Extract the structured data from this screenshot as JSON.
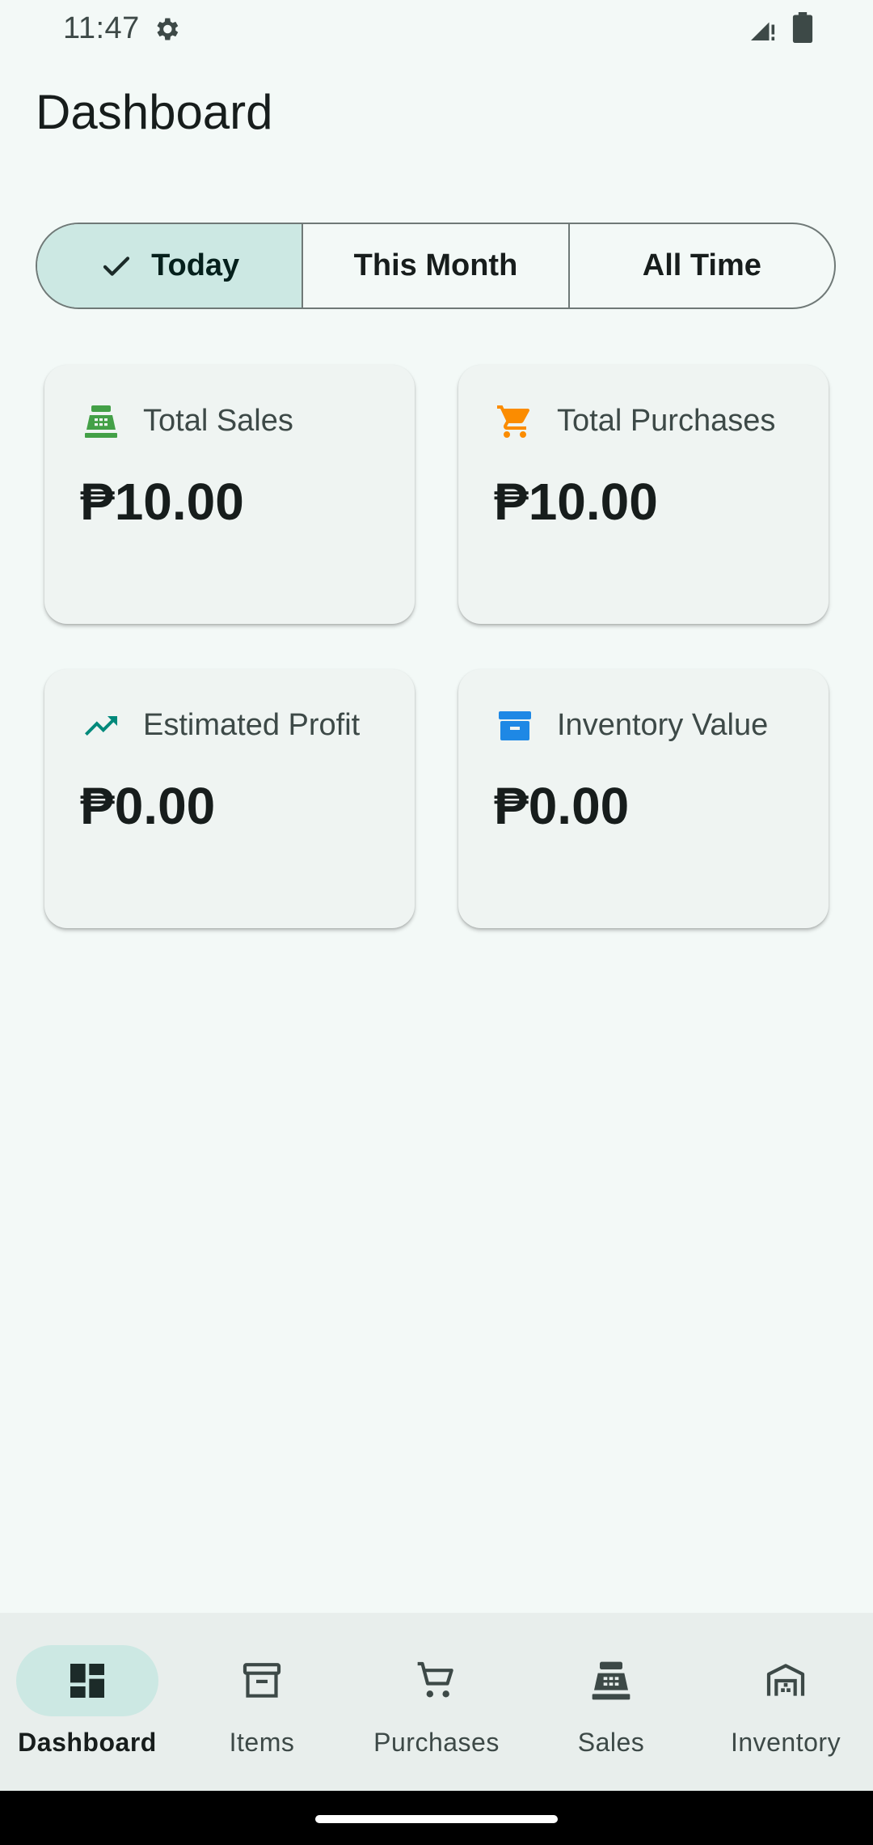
{
  "status_bar": {
    "time": "11:47",
    "icons": [
      "settings-gear-icon",
      "signal-icon",
      "battery-icon"
    ]
  },
  "page": {
    "title": "Dashboard"
  },
  "period_filter": {
    "selected": "Today",
    "options": [
      {
        "label": "Today",
        "selected": true,
        "icon": "check-icon"
      },
      {
        "label": "This Month",
        "selected": false
      },
      {
        "label": "All Time",
        "selected": false
      }
    ]
  },
  "cards": [
    {
      "label": "Total Sales",
      "value": "₱10.00",
      "icon": "cash-register-icon",
      "icon_color": "#43a047"
    },
    {
      "label": "Total Purchases",
      "value": "₱10.00",
      "icon": "shopping-cart-icon",
      "icon_color": "#fb8c00"
    },
    {
      "label": "Estimated Profit",
      "value": "₱0.00",
      "icon": "trending-up-icon",
      "icon_color": "#00897b"
    },
    {
      "label": "Inventory Value",
      "value": "₱0.00",
      "icon": "archive-box-icon",
      "icon_color": "#1e88e5"
    }
  ],
  "bottom_nav": {
    "active": "Dashboard",
    "items": [
      {
        "label": "Dashboard",
        "icon": "dashboard-icon",
        "active": true
      },
      {
        "label": "Items",
        "icon": "archive-icon",
        "active": false
      },
      {
        "label": "Purchases",
        "icon": "shopping-cart-icon",
        "active": false
      },
      {
        "label": "Sales",
        "icon": "cash-register-icon",
        "active": false
      },
      {
        "label": "Inventory",
        "icon": "warehouse-icon",
        "active": false
      }
    ]
  },
  "colors": {
    "background": "#f3f9f7",
    "selected_container": "#cce8e3",
    "card_background": "#eff4f2",
    "nav_background": "#e8eeec"
  }
}
